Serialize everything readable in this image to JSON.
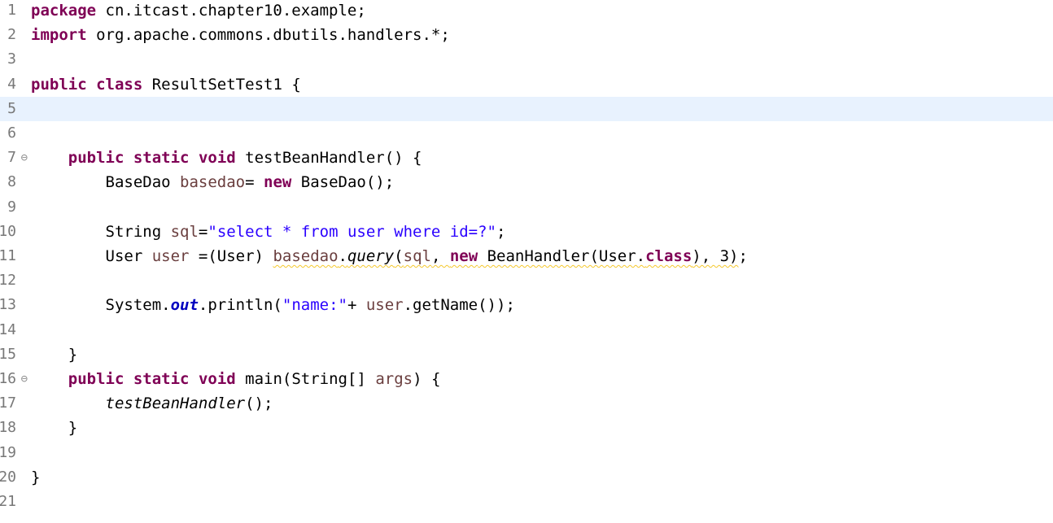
{
  "editor": {
    "lines": [
      {
        "n": "1",
        "fold": "",
        "current": false,
        "tokens": [
          {
            "t": "kw",
            "v": "package"
          },
          {
            "t": "plain",
            "v": " cn.itcast.chapter10.example;"
          }
        ]
      },
      {
        "n": "2",
        "fold": "",
        "current": false,
        "tokens": [
          {
            "t": "kw",
            "v": "import"
          },
          {
            "t": "plain",
            "v": " org.apache.commons.dbutils.handlers.*;"
          }
        ]
      },
      {
        "n": "3",
        "fold": "",
        "current": false,
        "tokens": []
      },
      {
        "n": "4",
        "fold": "",
        "current": false,
        "tokens": [
          {
            "t": "kw",
            "v": "public"
          },
          {
            "t": "plain",
            "v": " "
          },
          {
            "t": "kw",
            "v": "class"
          },
          {
            "t": "plain",
            "v": " ResultSetTest1 {"
          }
        ]
      },
      {
        "n": "5",
        "fold": "",
        "current": true,
        "tokens": []
      },
      {
        "n": "6",
        "fold": "",
        "current": false,
        "tokens": []
      },
      {
        "n": "7",
        "fold": "⊖",
        "current": false,
        "tokens": [
          {
            "t": "plain",
            "v": "    "
          },
          {
            "t": "kw",
            "v": "public"
          },
          {
            "t": "plain",
            "v": " "
          },
          {
            "t": "kw",
            "v": "static"
          },
          {
            "t": "plain",
            "v": " "
          },
          {
            "t": "kw",
            "v": "void"
          },
          {
            "t": "plain",
            "v": " testBeanHandler() {"
          }
        ]
      },
      {
        "n": "8",
        "fold": "",
        "current": false,
        "tokens": [
          {
            "t": "plain",
            "v": "        BaseDao "
          },
          {
            "t": "var",
            "v": "basedao"
          },
          {
            "t": "plain",
            "v": "= "
          },
          {
            "t": "kw",
            "v": "new"
          },
          {
            "t": "plain",
            "v": " BaseDao();"
          }
        ]
      },
      {
        "n": "9",
        "fold": "",
        "current": false,
        "tokens": []
      },
      {
        "n": "10",
        "fold": "",
        "current": false,
        "tokens": [
          {
            "t": "plain",
            "v": "        String "
          },
          {
            "t": "var",
            "v": "sql"
          },
          {
            "t": "plain",
            "v": "="
          },
          {
            "t": "str",
            "v": "\"select * from user where id=?\""
          },
          {
            "t": "plain",
            "v": ";"
          }
        ]
      },
      {
        "n": "11",
        "fold": "",
        "current": false,
        "tokens": [
          {
            "t": "plain",
            "v": "        User "
          },
          {
            "t": "var",
            "v": "user"
          },
          {
            "t": "plain",
            "v": " =(User) "
          },
          {
            "t": "var",
            "v": "basedao",
            "w": true
          },
          {
            "t": "plain",
            "v": ".",
            "w": true
          },
          {
            "t": "static-method",
            "v": "query",
            "w": true
          },
          {
            "t": "plain",
            "v": "(",
            "w": true
          },
          {
            "t": "var",
            "v": "sql",
            "w": true
          },
          {
            "t": "plain",
            "v": ", ",
            "w": true
          },
          {
            "t": "kw",
            "v": "new",
            "w": true
          },
          {
            "t": "plain",
            "v": " BeanHandler(User.",
            "w": true
          },
          {
            "t": "kw",
            "v": "class",
            "w": true
          },
          {
            "t": "plain",
            "v": "), 3)",
            "w": true
          },
          {
            "t": "plain",
            "v": ";"
          }
        ]
      },
      {
        "n": "12",
        "fold": "",
        "current": false,
        "tokens": []
      },
      {
        "n": "13",
        "fold": "",
        "current": false,
        "tokens": [
          {
            "t": "plain",
            "v": "        System."
          },
          {
            "t": "static-field",
            "v": "out"
          },
          {
            "t": "plain",
            "v": ".println("
          },
          {
            "t": "str",
            "v": "\"name:\""
          },
          {
            "t": "plain",
            "v": "+ "
          },
          {
            "t": "var",
            "v": "user"
          },
          {
            "t": "plain",
            "v": ".getName());"
          }
        ]
      },
      {
        "n": "14",
        "fold": "",
        "current": false,
        "tokens": []
      },
      {
        "n": "15",
        "fold": "",
        "current": false,
        "tokens": [
          {
            "t": "plain",
            "v": "    }"
          }
        ]
      },
      {
        "n": "16",
        "fold": "⊖",
        "current": false,
        "tokens": [
          {
            "t": "plain",
            "v": "    "
          },
          {
            "t": "kw",
            "v": "public"
          },
          {
            "t": "plain",
            "v": " "
          },
          {
            "t": "kw",
            "v": "static"
          },
          {
            "t": "plain",
            "v": " "
          },
          {
            "t": "kw",
            "v": "void"
          },
          {
            "t": "plain",
            "v": " main(String[] "
          },
          {
            "t": "var",
            "v": "args"
          },
          {
            "t": "plain",
            "v": ") {"
          }
        ]
      },
      {
        "n": "17",
        "fold": "",
        "current": false,
        "tokens": [
          {
            "t": "plain",
            "v": "        "
          },
          {
            "t": "static-method",
            "v": "testBeanHandler"
          },
          {
            "t": "plain",
            "v": "();"
          }
        ]
      },
      {
        "n": "18",
        "fold": "",
        "current": false,
        "tokens": [
          {
            "t": "plain",
            "v": "    }"
          }
        ]
      },
      {
        "n": "19",
        "fold": "",
        "current": false,
        "tokens": []
      },
      {
        "n": "20",
        "fold": "",
        "current": false,
        "tokens": [
          {
            "t": "plain",
            "v": "}"
          }
        ]
      },
      {
        "n": "21",
        "fold": "",
        "current": false,
        "tokens": []
      }
    ]
  }
}
